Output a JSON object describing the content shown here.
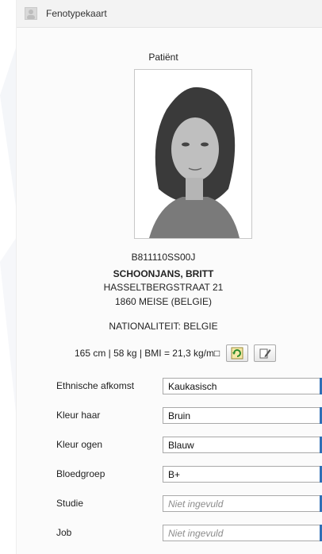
{
  "header": {
    "title": "Fenotypekaart",
    "icon": "person-placeholder-icon"
  },
  "patient": {
    "section_label": "Patiënt",
    "id": "B811110SS00J",
    "name": "SCHOONJANS, BRITT",
    "address_line1": "HASSELTBERGSTRAAT 21",
    "address_line2": "1860 MEISE (BELGIE)",
    "nationality": "NATIONALITEIT: BELGIE",
    "metrics": "165 cm | 58 kg | BMI = 21,3 kg/m□"
  },
  "buttons": {
    "refresh_icon": "refresh-icon",
    "edit_icon": "edit-icon"
  },
  "fields": [
    {
      "label": "Ethnische afkomst",
      "value": "Kaukasisch",
      "placeholder": false
    },
    {
      "label": "Kleur haar",
      "value": "Bruin",
      "placeholder": false
    },
    {
      "label": "Kleur ogen",
      "value": "Blauw",
      "placeholder": false
    },
    {
      "label": "Bloedgroep",
      "value": "B+",
      "placeholder": false
    },
    {
      "label": "Studie",
      "value": "Niet ingevuld",
      "placeholder": true
    },
    {
      "label": "Job",
      "value": "Niet ingevuld",
      "placeholder": true
    }
  ],
  "colors": {
    "accent": "#2f6fb6",
    "placeholder_text": "#8c8c8c"
  }
}
